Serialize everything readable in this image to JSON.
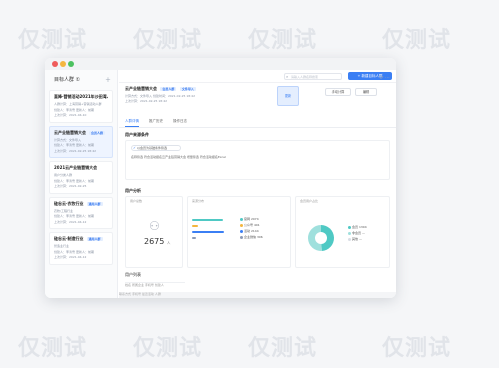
{
  "watermark": "仅测试",
  "left_panel": {
    "header": "目标人群 ①",
    "add_icon": "plus-icon",
    "items": [
      {
        "title": "直降·营销活动2021年沙田湾人群",
        "lines": [
          "人群计算：上海营销+营销活动人群",
          "创建人：李清雪  更新人：前期",
          "上次计算：2021-04-10"
        ],
        "tag": ""
      },
      {
        "title": "云产业链营销大会",
        "tag": "会员人群",
        "lines": [
          "计算方式：文件导入",
          "创建人：李清雪  更新人：前期",
          "上次计算：2021-02-25 18:42"
        ]
      },
      {
        "title": "2021云产业链营销大会",
        "tag": "",
        "lines": [
          "用户分类人群",
          "创建人：李清雪  更新人：前期",
          "上次计算：2021-02-25"
        ]
      },
      {
        "title": "硅谷云·农牧行业",
        "tag": "通用人群",
        "lines": [
          "农牧/工程行业",
          "创建人：李清雪  更新人：前期",
          "上次计算：2021-04-12"
        ]
      },
      {
        "title": "硅谷云·制造行业",
        "tag": "通用人群",
        "lines": [
          "智造业行业",
          "创建人：李清雪  更新人：前期",
          "上次计算：2021-04-12"
        ]
      }
    ]
  },
  "toolbar": {
    "search_placeholder": "请输入人群名称搜索",
    "search_icon": "search-icon",
    "primary_button": "+ 新建目标人群"
  },
  "detail": {
    "title": "云产业链营销大会",
    "tags": [
      "会员人群",
      "文件导入"
    ],
    "row1": "计算方式：文件导入   创建时间：2021-02-25 18:42",
    "row2": "上次计算：2021-02-25 18:42",
    "btn_edit": "手动计算",
    "btn_update": "编辑",
    "btn_recalc": "更新",
    "right_icons": [
      "refresh-icon",
      "more-icon"
    ]
  },
  "tabs": [
    "人群详情",
    "推广历史",
    "操作日志"
  ],
  "source": {
    "section_title": "用户来源条件",
    "chip": "以会员为基础条件筛选",
    "description": "名称筛选  符合活动报名云产业链营销大会   增量筛选  符合活动报名Excel"
  },
  "stats": {
    "section_title": "用户分析",
    "total_label": "用户总数",
    "total": "2675",
    "total_unit": "人",
    "source_label": "来源分布",
    "sources": [
      {
        "name": "官网",
        "value": "2074",
        "pct": 0.78,
        "color": "#4fc9c4"
      },
      {
        "name": "公众号",
        "value": "401",
        "pct": 0.15,
        "color": "#f4b63f"
      },
      {
        "name": "活动",
        "value": "2144",
        "pct": 0.8,
        "color": "#3b7ff4"
      },
      {
        "name": "企业微信",
        "value": "306",
        "pct": 0.11,
        "color": "#8e9bb5"
      }
    ],
    "pie_label": "会员用户占比",
    "pie": [
      {
        "name": "会员",
        "value": "1304",
        "pct": 0.49,
        "color": "#4fc9c4"
      },
      {
        "name": "非会员",
        "value": "—",
        "pct": 0.51,
        "color": "#9fe0dd"
      },
      {
        "name": "其他",
        "value": "—",
        "pct": 0.0,
        "color": "#d9dde5"
      }
    ]
  },
  "list": {
    "title": "用户列表",
    "first_row": "姓名  所属企业  手机号  创建人"
  },
  "bottom_text": "联系方式  手机号  最近活动  人群"
}
